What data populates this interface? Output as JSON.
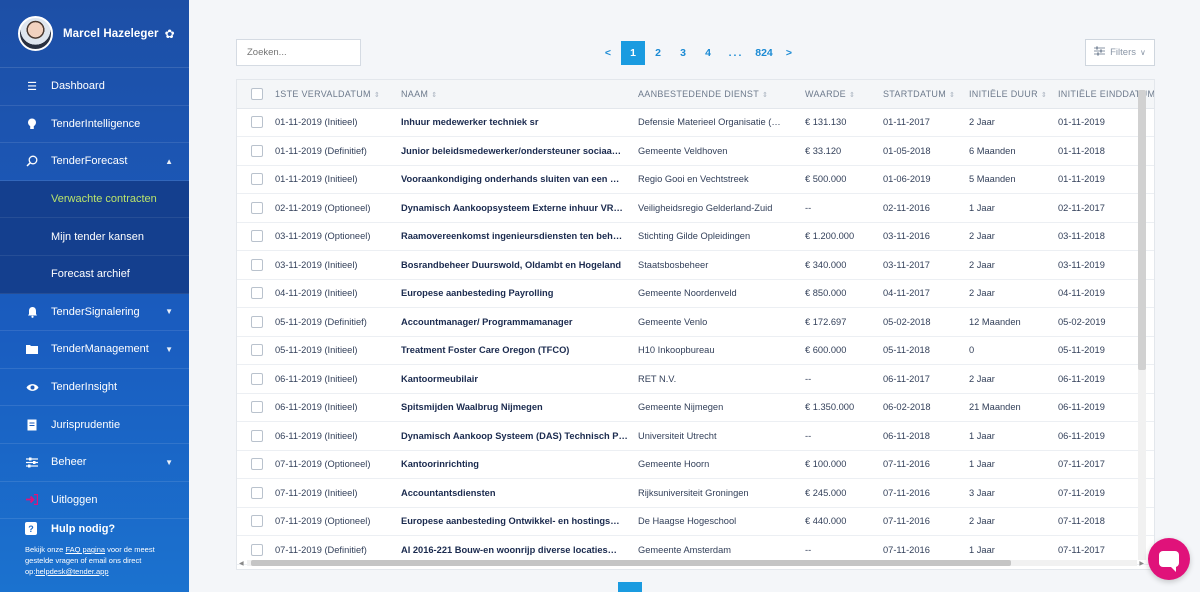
{
  "user": {
    "name": "Marcel Hazeleger"
  },
  "sidebar": {
    "items": [
      {
        "label": "Dashboard",
        "icon": "list-icon"
      },
      {
        "label": "TenderIntelligence",
        "icon": "lightbulb-icon"
      },
      {
        "label": "TenderForecast",
        "icon": "search-icon",
        "chevron": "▲"
      },
      {
        "label": "TenderSignalering",
        "icon": "bell-icon",
        "chevron": "▼"
      },
      {
        "label": "TenderManagement",
        "icon": "folder-icon",
        "chevron": "▼"
      },
      {
        "label": "TenderInsight",
        "icon": "eye-icon"
      },
      {
        "label": "Jurisprudentie",
        "icon": "document-icon"
      },
      {
        "label": "Beheer",
        "icon": "sliders-icon",
        "chevron": "▼"
      },
      {
        "label": "Uitloggen",
        "icon": "logout-icon"
      }
    ],
    "subitems": [
      {
        "label": "Verwachte contracten"
      },
      {
        "label": "Mijn tender kansen"
      },
      {
        "label": "Forecast archief"
      }
    ],
    "help": {
      "title": "Hulp nodig?",
      "text1": "Bekijk onze ",
      "faq_link": "FAQ pagina",
      "text2": " voor de meest gestelde vragen of email ons direct op:",
      "email": "helpdesk@tender.app"
    }
  },
  "search": {
    "placeholder": "Zoeken..."
  },
  "pagination": {
    "prev": "<",
    "pages": [
      "1",
      "2",
      "3",
      "4"
    ],
    "dots": "...",
    "last": "824",
    "next": ">"
  },
  "filters": {
    "label": "Filters"
  },
  "table": {
    "columns": [
      "1STE VERVALDATUM",
      "NAAM",
      "AANBESTEDENDE DIENST",
      "WAARDE",
      "STARTDATUM",
      "INITIËLE DUUR",
      "INITIËLE EINDDATUM"
    ],
    "rows": [
      [
        "01-11-2019 (Initieel)",
        "Inhuur medewerker techniek sr",
        "Defensie Materieel Organisatie (…",
        "€ 131.130",
        "01-11-2017",
        "2 Jaar",
        "01-11-2019"
      ],
      [
        "01-11-2019 (Definitief)",
        "Junior beleidsmedewerker/ondersteuner sociaa…",
        "Gemeente Veldhoven",
        "€ 33.120",
        "01-05-2018",
        "6 Maanden",
        "01-11-2018"
      ],
      [
        "01-11-2019 (Initieel)",
        "Vooraankondiging onderhands sluiten van een …",
        "Regio Gooi en Vechtstreek",
        "€ 500.000",
        "01-06-2019",
        "5 Maanden",
        "01-11-2019"
      ],
      [
        "02-11-2019 (Optioneel)",
        "Dynamisch Aankoopsysteem Externe inhuur VR…",
        "Veiligheidsregio Gelderland-Zuid",
        "--",
        "02-11-2016",
        "1 Jaar",
        "02-11-2017"
      ],
      [
        "03-11-2019 (Optioneel)",
        "Raamovereenkomst ingenieursdiensten ten beh…",
        "Stichting Gilde Opleidingen",
        "€ 1.200.000",
        "03-11-2016",
        "2 Jaar",
        "03-11-2018"
      ],
      [
        "03-11-2019 (Initieel)",
        "Bosrandbeheer Duurswold, Oldambt en Hogeland",
        "Staatsbosbeheer",
        "€ 340.000",
        "03-11-2017",
        "2 Jaar",
        "03-11-2019"
      ],
      [
        "04-11-2019 (Initieel)",
        "Europese aanbesteding Payrolling",
        "Gemeente Noordenveld",
        "€ 850.000",
        "04-11-2017",
        "2 Jaar",
        "04-11-2019"
      ],
      [
        "05-11-2019 (Definitief)",
        "Accountmanager/ Programmamanager",
        "Gemeente Venlo",
        "€ 172.697",
        "05-02-2018",
        "12 Maanden",
        "05-02-2019"
      ],
      [
        "05-11-2019 (Initieel)",
        "Treatment Foster Care Oregon (TFCO)",
        "H10 Inkoopbureau",
        "€ 600.000",
        "05-11-2018",
        "0",
        "05-11-2019"
      ],
      [
        "06-11-2019 (Initieel)",
        "Kantoormeubilair",
        "RET N.V.",
        "--",
        "06-11-2017",
        "2 Jaar",
        "06-11-2019"
      ],
      [
        "06-11-2019 (Initieel)",
        "Spitsmijden Waalbrug Nijmegen",
        "Gemeente Nijmegen",
        "€ 1.350.000",
        "06-02-2018",
        "21 Maanden",
        "06-11-2019"
      ],
      [
        "06-11-2019 (Initieel)",
        "Dynamisch Aankoop Systeem (DAS) Technisch P…",
        "Universiteit Utrecht",
        "--",
        "06-11-2018",
        "1 Jaar",
        "06-11-2019"
      ],
      [
        "07-11-2019 (Optioneel)",
        "Kantoorinrichting",
        "Gemeente Hoorn",
        "€ 100.000",
        "07-11-2016",
        "1 Jaar",
        "07-11-2017"
      ],
      [
        "07-11-2019 (Initieel)",
        "Accountantsdiensten",
        "Rijksuniversiteit Groningen",
        "€ 245.000",
        "07-11-2016",
        "3 Jaar",
        "07-11-2019"
      ],
      [
        "07-11-2019 (Optioneel)",
        "Europese aanbesteding Ontwikkel- en hostings…",
        "De Haagse Hogeschool",
        "€ 440.000",
        "07-11-2016",
        "2 Jaar",
        "07-11-2018"
      ],
      [
        "07-11-2019 (Definitief)",
        "AI 2016-221 Bouw-en woonrijp diverse locaties…",
        "Gemeente Amsterdam",
        "--",
        "07-11-2016",
        "1 Jaar",
        "07-11-2017"
      ]
    ]
  },
  "colors": {
    "sidebar": "#1d4fa6",
    "accent": "#1a9be0",
    "active_sub": "#b9e36b",
    "chat": "#e0127a"
  }
}
